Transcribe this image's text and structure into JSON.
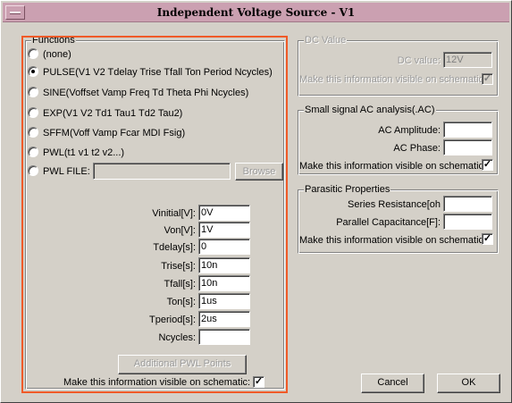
{
  "window": {
    "title": "Independent Voltage Source - V1"
  },
  "functions": {
    "group_label": "Functions",
    "options": [
      {
        "label": "(none)",
        "checked": false
      },
      {
        "label": "PULSE(V1 V2 Tdelay Trise Tfall Ton Period Ncycles)",
        "checked": true
      },
      {
        "label": "SINE(Voffset Vamp Freq Td Theta Phi Ncycles)",
        "checked": false
      },
      {
        "label": "EXP(V1 V2 Td1 Tau1 Td2 Tau2)",
        "checked": false
      },
      {
        "label": "SFFM(Voff Vamp Fcar MDI Fsig)",
        "checked": false
      },
      {
        "label": "PWL(t1 v1 t2 v2...)",
        "checked": false
      },
      {
        "label": "PWL FILE:",
        "checked": false
      }
    ],
    "pwl_file_value": "",
    "browse_label": "Browse",
    "params": [
      {
        "label": "Vinitial[V]:",
        "value": "0V"
      },
      {
        "label": "Von[V]:",
        "value": "1V"
      },
      {
        "label": "Tdelay[s]:",
        "value": "0"
      },
      {
        "label": "Trise[s]:",
        "value": "10n"
      },
      {
        "label": "Tfall[s]:",
        "value": "10n"
      },
      {
        "label": "Ton[s]:",
        "value": "1us"
      },
      {
        "label": "Tperiod[s]:",
        "value": "2us"
      },
      {
        "label": "Ncycles:",
        "value": ""
      }
    ],
    "additional_pwl_label": "Additional PWL Points",
    "visible_label": "Make this information visible on schematic:",
    "visible_checked": "✓"
  },
  "dc": {
    "group_label": "DC Value",
    "value_label": "DC value:",
    "value": "12V",
    "visible_label": "Make this information visible on schematic:",
    "visible_checked": "✓"
  },
  "ac": {
    "group_label": "Small signal AC analysis(.AC)",
    "amplitude_label": "AC Amplitude:",
    "amplitude_value": "",
    "phase_label": "AC Phase:",
    "phase_value": "",
    "visible_label": "Make this information visible on schematic:",
    "visible_checked": "✓"
  },
  "parasitic": {
    "group_label": "Parasitic Properties",
    "series_label": "Series Resistance[oh",
    "series_value": "",
    "parallel_label": "Parallel Capacitance[F]:",
    "parallel_value": "",
    "visible_label": "Make this information visible on schematic:",
    "visible_checked": "✓"
  },
  "buttons": {
    "cancel": "Cancel",
    "ok": "OK"
  },
  "colors": {
    "highlight": "#f05a28",
    "titlebar": "#cba0b1",
    "face": "#d4d0c8"
  }
}
